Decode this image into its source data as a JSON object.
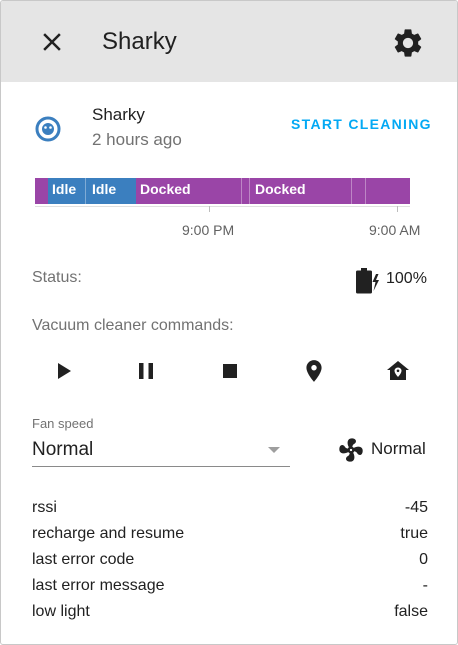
{
  "header": {
    "title": "Sharky",
    "close_icon": "close-icon",
    "settings_icon": "gear-icon"
  },
  "entity": {
    "name": "Sharky",
    "last_changed": "2 hours ago",
    "icon": "robot-vacuum-icon",
    "action_label": "START CLEANING",
    "accent_color": "#03a9f4"
  },
  "history": {
    "segments": [
      {
        "label": "",
        "state": "idle",
        "color": "#3b7fbf"
      },
      {
        "label": "Idle",
        "state": "idle",
        "color": "#3b7fbf"
      },
      {
        "label": "Idle",
        "state": "idle",
        "color": "#3b7fbf"
      },
      {
        "label": "Docked",
        "state": "docked",
        "color": "#9a45a7"
      },
      {
        "label": "Docked",
        "state": "docked",
        "color": "#9a45a7"
      }
    ],
    "axis_labels": [
      "9:00 PM",
      "9:00 AM"
    ]
  },
  "status": {
    "label": "Status:",
    "battery_icon": "battery-charging-icon",
    "battery_level": "100%"
  },
  "commands": {
    "label": "Vacuum cleaner commands:",
    "buttons": [
      "play-icon",
      "pause-icon",
      "stop-icon",
      "map-marker-icon",
      "home-map-marker-icon"
    ]
  },
  "fan_speed": {
    "label": "Fan speed",
    "selected": "Normal",
    "current": "Normal",
    "icon": "fan-icon"
  },
  "attributes": [
    {
      "key": "rssi",
      "value": "-45"
    },
    {
      "key": "recharge and resume",
      "value": "true"
    },
    {
      "key": "last error code",
      "value": "0"
    },
    {
      "key": "last error message",
      "value": "-"
    },
    {
      "key": "low light",
      "value": "false"
    }
  ]
}
